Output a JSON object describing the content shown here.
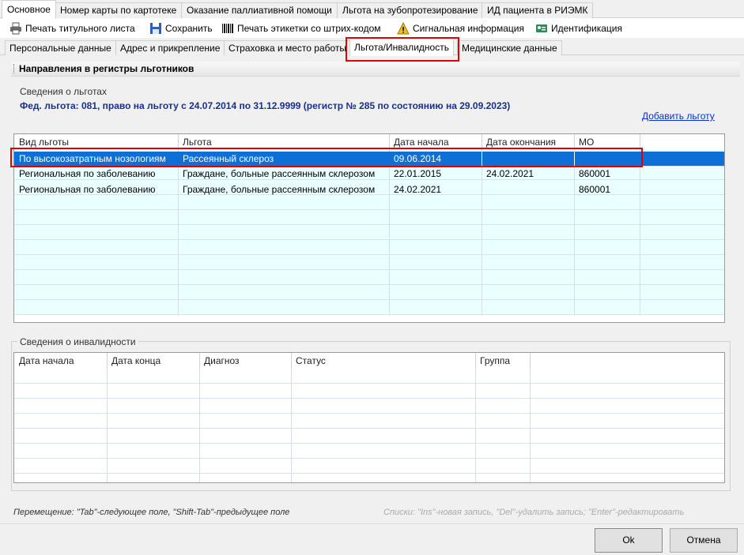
{
  "top_tabs": [
    {
      "label": "Основное"
    },
    {
      "label": "Номер карты по картотеке"
    },
    {
      "label": "Оказание паллиативной помощи"
    },
    {
      "label": "Льгота на зубопротезирование"
    },
    {
      "label": "ИД пациента в РИЭМК"
    }
  ],
  "toolbar": {
    "print_title": "Печать титульного листа",
    "save": "Сохранить",
    "print_barcode": "Печать этикетки со штрих-кодом",
    "signal_info": "Сигнальная информация",
    "identification": "Идентификация",
    "icons": [
      "printer-icon",
      "floppy-disk-icon",
      "barcode-icon",
      "warning-icon",
      "id-card-icon"
    ]
  },
  "sub_tabs": [
    {
      "label": "Персональные данные"
    },
    {
      "label": "Адрес и прикрепление"
    },
    {
      "label": "Страховка и место работы"
    },
    {
      "label": "Льгота/Инвалидность"
    },
    {
      "label": "Медицинские данные"
    }
  ],
  "section_title": "Направления в регистры льготников",
  "benefits": {
    "group_label": "Сведения о льготах",
    "federal_line": "Фед. льгота: 081, право на льготу с 24.07.2014 по 31.12.9999 (регистр № 285 по состоянию на 29.09.2023)",
    "add_link": "Добавить льготу",
    "columns": [
      "Вид льготы",
      "Льгота",
      "Дата начала",
      "Дата окончания",
      "МО"
    ],
    "rows": [
      [
        "По высокозатратным нозологиям",
        "Рассеянный склероз",
        "09.06.2014",
        "",
        ""
      ],
      [
        "Региональная по заболеванию",
        "Граждане, больные рассеянным склерозом",
        "22.01.2015",
        "24.02.2021",
        "860001"
      ],
      [
        "Региональная по заболеванию",
        "Граждане, больные рассеянным склерозом",
        "24.02.2021",
        "",
        "860001"
      ]
    ]
  },
  "disability": {
    "group_label": "Сведения о инвалидности",
    "columns": [
      "Дата начала",
      "Дата конца",
      "Диагноз",
      "Статус",
      "Группа"
    ]
  },
  "hints": {
    "left": "Перемещение: \"Tab\"-следующее поле, \"Shift-Tab\"-предыдущее поле",
    "right": "Списки: \"Ins\"-новая запись, \"Del\"-удалить запись; \"Enter\"-редактировать"
  },
  "buttons": {
    "ok": "Ok",
    "cancel": "Отмена"
  },
  "colors": {
    "selection": "#0e6fd6",
    "highlight_box": "#e00000",
    "link": "#0033cc",
    "fed_text": "#1a2f8a",
    "grid_tint": "#eaffff"
  }
}
